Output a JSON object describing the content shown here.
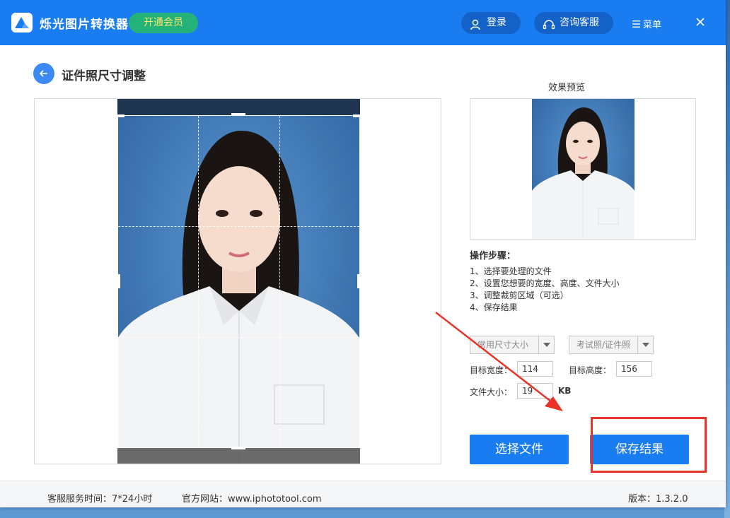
{
  "app": {
    "title": "烁光图片转换器",
    "vip_label": "开通会员",
    "login_label": "登录",
    "service_label": "咨询客服",
    "menu_label": "菜单"
  },
  "page": {
    "title": "证件照尺寸调整"
  },
  "preview": {
    "label": "效果预览"
  },
  "steps": {
    "title": "操作步骤：",
    "items": [
      "1、选择要处理的文件",
      "2、设置您想要的宽度、高度、文件大小",
      "3、调整裁剪区域（可选）",
      "4、保存结果"
    ]
  },
  "form": {
    "size_select": "常用尺寸大小",
    "type_select": "考试照/证件照",
    "width_label": "目标宽度：",
    "width_value": "114",
    "height_label": "目标高度：",
    "height_value": "156",
    "filesize_label": "文件大小：",
    "filesize_value": "19",
    "filesize_unit": "KB"
  },
  "actions": {
    "choose_file": "选择文件",
    "save_result": "保存结果"
  },
  "footer": {
    "service_hours": "客服服务时间：7*24小时",
    "website": "官方网站：www.iphototool.com",
    "version": "版本：1.3.2.0"
  },
  "colors": {
    "brand": "#1a7cf1",
    "vip": "#23b27a",
    "highlight": "#e8332b"
  }
}
